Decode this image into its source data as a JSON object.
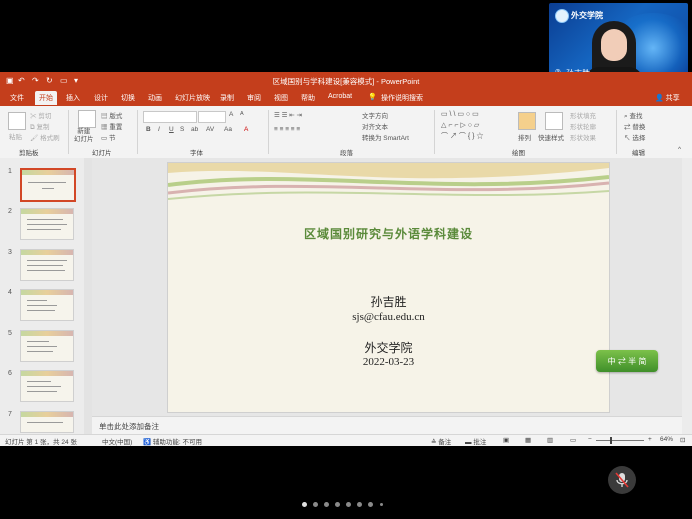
{
  "camera": {
    "school": "外交学院",
    "speaker_name": "孙吉胜"
  },
  "window": {
    "title": "区域国别与学科建设[兼容模式] - PowerPoint"
  },
  "menu": {
    "tabs": [
      "文件",
      "开始",
      "插入",
      "设计",
      "切换",
      "动画",
      "幻灯片放映",
      "录制",
      "审阅",
      "视图",
      "帮助",
      "Acrobat"
    ],
    "active_tab": "开始",
    "tell_me": "操作说明搜索",
    "share": "共享"
  },
  "ribbon": {
    "clipboard": {
      "paste": "粘贴",
      "cut": "剪切",
      "copy": "复制",
      "format_painter": "格式刷",
      "label": "剪贴板"
    },
    "slides": {
      "new_slide": "新建\n幻灯片",
      "layout": "版式",
      "reset": "重置",
      "section": "节",
      "label": "幻灯片"
    },
    "font": {
      "label": "字体",
      "bold": "B",
      "italic": "I",
      "underline": "U",
      "strike": "S",
      "shadow": "ab",
      "spacing": "AV",
      "case": "Aa",
      "grow": "A",
      "shrink": "A"
    },
    "paragraph": {
      "text_direction": "文字方向",
      "align_text": "对齐文本",
      "smartart": "转换为 SmartArt",
      "label": "段落"
    },
    "drawing": {
      "arrange": "排列",
      "quick_styles": "快速样式",
      "shape_fill": "形状填充",
      "shape_outline": "形状轮廓",
      "shape_effects": "形状效果",
      "label": "绘图"
    },
    "editing": {
      "find": "查找",
      "replace": "替换",
      "select": "选择",
      "label": "编辑"
    }
  },
  "thumbnails": [
    "1",
    "2",
    "3",
    "4",
    "5",
    "6",
    "7"
  ],
  "slide": {
    "title": "区域国别研究与外语学科建设",
    "author": "孙吉胜",
    "email": "sjs@cfau.edu.cn",
    "org": "外交学院",
    "date": "2022-03-23"
  },
  "notes_placeholder": "单击此处添加备注",
  "status": {
    "slide_info": "幻灯片 第 1 张，共 24 张",
    "language": "中文(中国)",
    "accessibility": "辅助功能: 不可用",
    "notes": "备注",
    "comments": "批注",
    "zoom": "64%"
  },
  "badge_text": "中 ⇄ 半 简",
  "colors": {
    "accent": "#c43e1c",
    "slide_title": "#5a8a3a"
  }
}
